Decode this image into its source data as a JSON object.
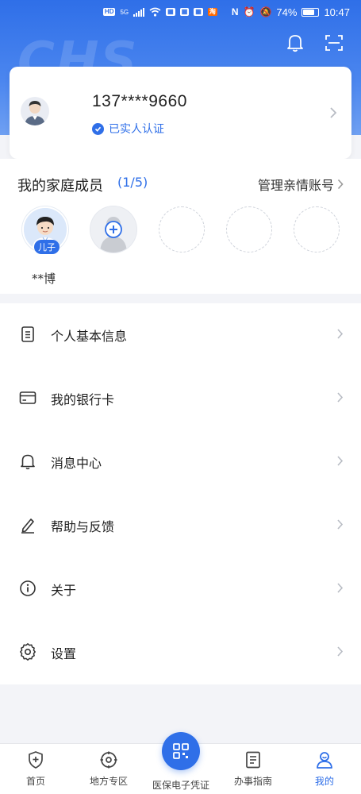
{
  "status_bar": {
    "battery": "74%",
    "time": "10:47",
    "hd_label": "HD",
    "network": "5G"
  },
  "header": {
    "watermark": "CHS"
  },
  "profile": {
    "phone": "137****9660",
    "verified_label": "已实人认证"
  },
  "family": {
    "title": "我的家庭成员",
    "count": "(1/5)",
    "manage_label": "管理亲情账号",
    "members": [
      {
        "name": "**博",
        "tag": "儿子"
      }
    ]
  },
  "menu": [
    {
      "label": "个人基本信息",
      "icon": "document-icon"
    },
    {
      "label": "我的银行卡",
      "icon": "bank-card-icon"
    },
    {
      "label": "消息中心",
      "icon": "bell-icon"
    },
    {
      "label": "帮助与反馈",
      "icon": "pen-icon"
    },
    {
      "label": "关于",
      "icon": "info-icon"
    },
    {
      "label": "设置",
      "icon": "gear-icon"
    }
  ],
  "bottom_nav": [
    {
      "label": "首页",
      "icon": "shield-plus-icon"
    },
    {
      "label": "地方专区",
      "icon": "target-icon"
    },
    {
      "label": "医保电子凭证",
      "icon": "qr-code-icon"
    },
    {
      "label": "办事指南",
      "icon": "guide-icon"
    },
    {
      "label": "我的",
      "icon": "user-icon",
      "active": true
    }
  ],
  "colors": {
    "primary": "#2f6fe8",
    "background": "#f3f4f8"
  }
}
